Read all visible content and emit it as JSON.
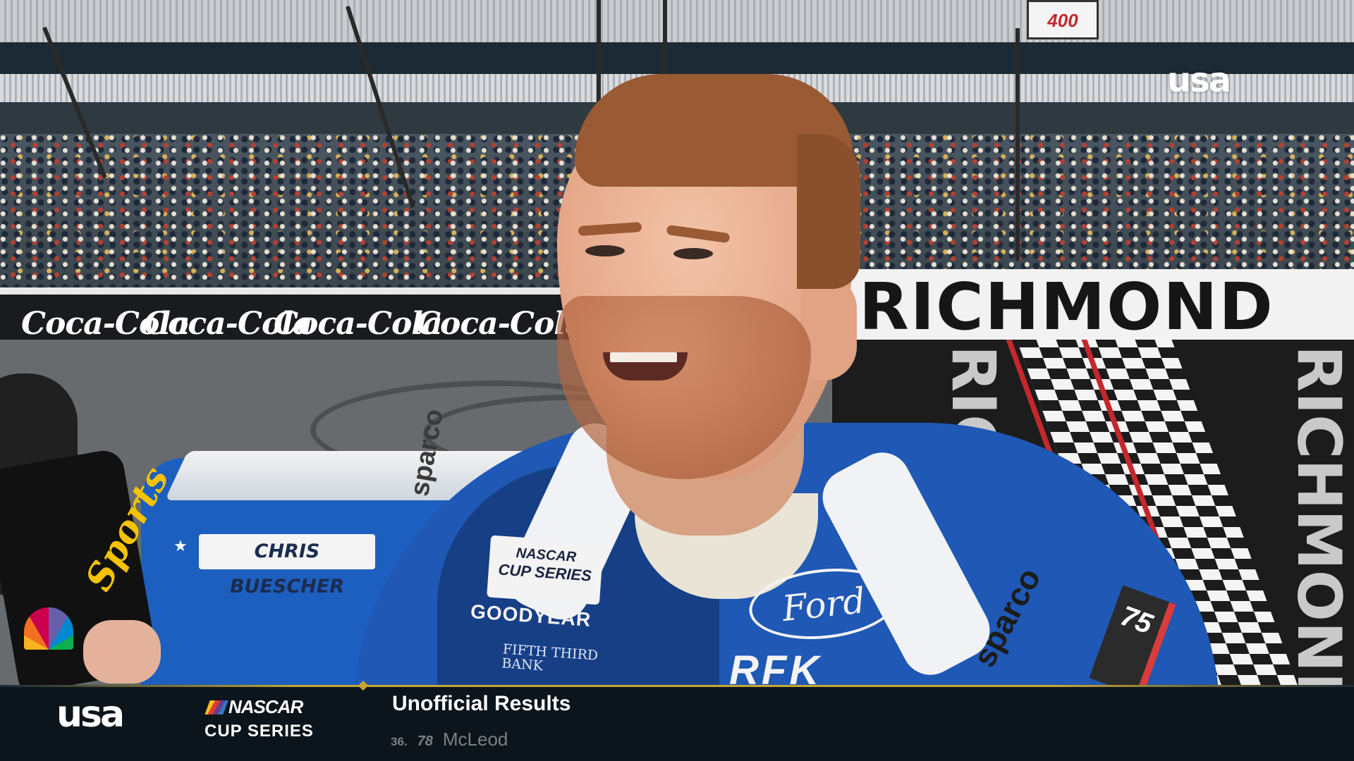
{
  "broadcast": {
    "network_bug": "usa",
    "venue_sign_text": "RICHMOND",
    "event_sign_text": "400",
    "wall_sponsor_text": "Coca-Cola"
  },
  "car": {
    "driver_name": "CHRIS BUESCHER"
  },
  "driver_suit": {
    "nascar_patch_line1": "NASCAR",
    "nascar_patch_line2": "CUP SERIES",
    "goodyear": "GOODYEAR",
    "fifth_third_line1": "FIFTH THIRD",
    "fifth_third_line2": "BANK",
    "ford": "Ford",
    "sparco": "sparco",
    "number": "75",
    "rfk": "RFK"
  },
  "microphone": {
    "flag_text": "Sports"
  },
  "ticker": {
    "network_logo": "usa",
    "series_brand": "NASCAR",
    "series_name": "CUP SERIES",
    "title": "Unofficial Results",
    "current_row": {
      "position": "36.",
      "car_number": "78",
      "driver": "McLeod"
    }
  },
  "colors": {
    "ticker_background": "#0c151c",
    "ticker_accent": "#c5a536",
    "suit_blue": "#1f58b5"
  }
}
